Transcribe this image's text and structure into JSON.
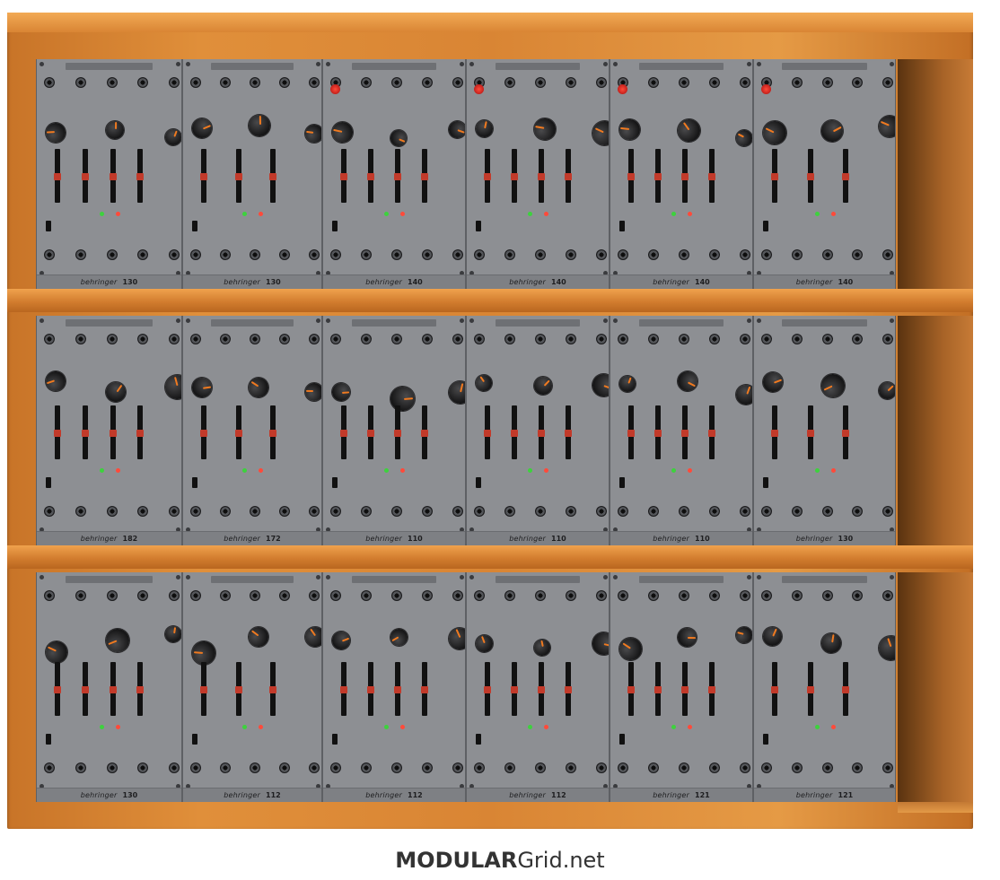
{
  "brand_logo": {
    "bold": "MODULAR",
    "rest": "Grid.net"
  },
  "module_brand": "behringer",
  "rows": [
    {
      "name": "row-1",
      "modules": [
        {
          "model": "130",
          "width": 163
        },
        {
          "model": "130",
          "width": 156
        },
        {
          "model": "140",
          "width": 160
        },
        {
          "model": "140",
          "width": 160
        },
        {
          "model": "140",
          "width": 160
        },
        {
          "model": "140",
          "width": 159
        }
      ]
    },
    {
      "name": "row-2",
      "modules": [
        {
          "model": "182",
          "width": 163
        },
        {
          "model": "172",
          "width": 156
        },
        {
          "model": "110",
          "width": 160
        },
        {
          "model": "110",
          "width": 160
        },
        {
          "model": "110",
          "width": 160
        },
        {
          "model": "130",
          "width": 159
        }
      ]
    },
    {
      "name": "row-3",
      "modules": [
        {
          "model": "130",
          "width": 163
        },
        {
          "model": "112",
          "width": 156
        },
        {
          "model": "112",
          "width": 160
        },
        {
          "model": "112",
          "width": 160
        },
        {
          "model": "121",
          "width": 160
        },
        {
          "model": "121",
          "width": 159
        }
      ]
    }
  ],
  "colors": {
    "wood": "#d98534",
    "panel": "#8d8f93",
    "knob_indicator": "#f07a20",
    "slider_cap": "#c23a2a",
    "led_red": "#ff4a3a",
    "led_green": "#3dd23d"
  }
}
